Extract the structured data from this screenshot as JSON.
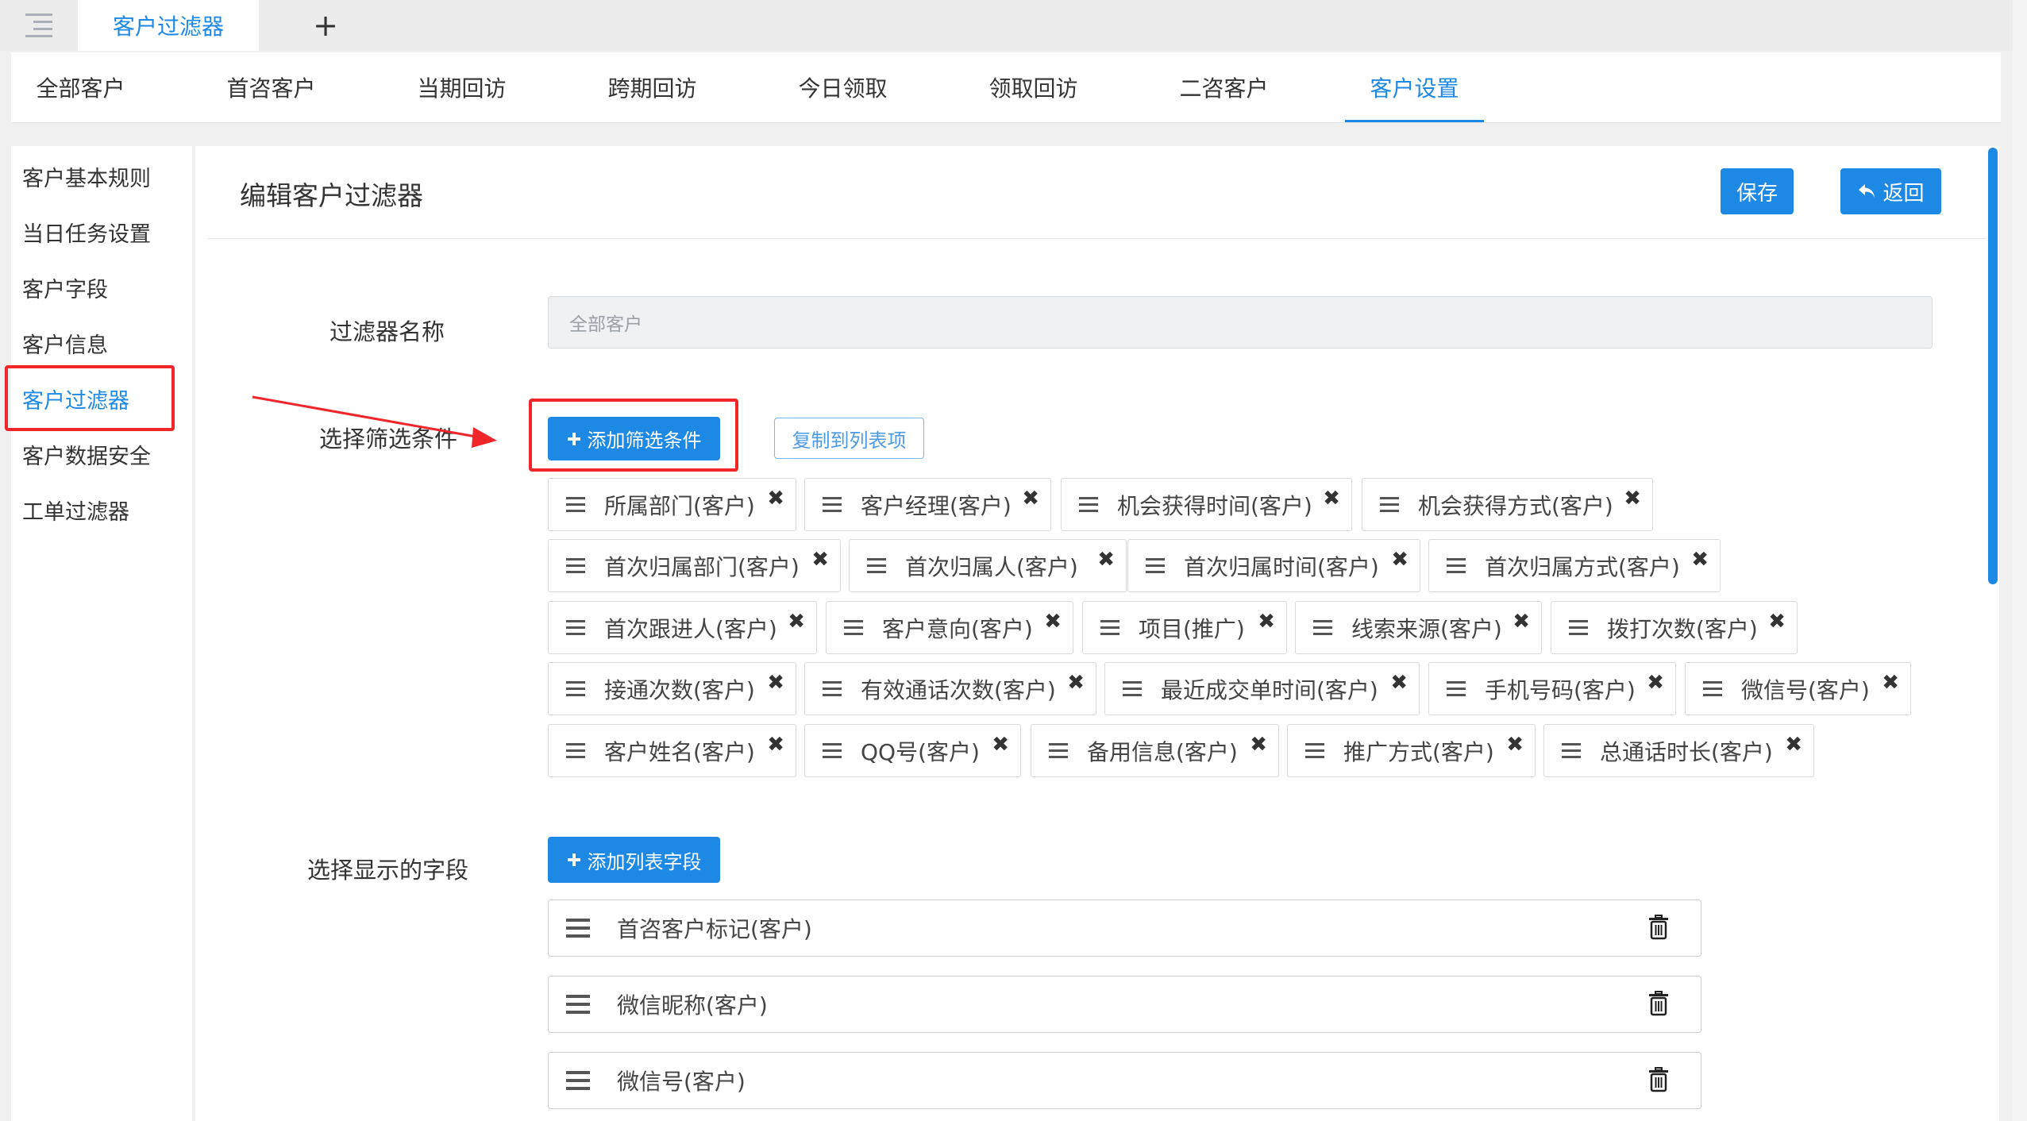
{
  "top_tabs": {
    "active_tab": "客户过滤器",
    "add_symbol": "+"
  },
  "subtabs": [
    "全部客户",
    "首咨客户",
    "当期回访",
    "跨期回访",
    "今日领取",
    "领取回访",
    "二咨客户",
    "客户设置"
  ],
  "sidebar": [
    "客户基本规则",
    "当日任务设置",
    "客户字段",
    "客户信息",
    "客户过滤器",
    "客户数据安全",
    "工单过滤器"
  ],
  "panel": {
    "title": "编辑客户过滤器",
    "save": "保存",
    "back": "返回"
  },
  "form": {
    "name_label": "过滤器名称",
    "name_value": "全部客户",
    "conditions_label": "选择筛选条件",
    "add_condition": "添加筛选条件",
    "copy_to_list": "复制到列表项",
    "conditions": [
      "所属部门(客户)",
      "客户经理(客户)",
      "机会获得时间(客户)",
      "机会获得方式(客户)",
      "首次归属部门(客户)",
      "首次归属人(客户)",
      "首次归属时间(客户)",
      "首次归属方式(客户)",
      "首次跟进人(客户)",
      "客户意向(客户)",
      "项目(推广)",
      "线索来源(客户)",
      "拨打次数(客户)",
      "接通次数(客户)",
      "有效通话次数(客户)",
      "最近成交单时间(客户)",
      "手机号码(客户)",
      "微信号(客户)",
      "客户姓名(客户)",
      "QQ号(客户)",
      "备用信息(客户)",
      "推广方式(客户)",
      "总通话时长(客户)"
    ],
    "fields_label": "选择显示的字段",
    "add_field": "添加列表字段",
    "fields": [
      "首咨客户标记(客户)",
      "微信昵称(客户)",
      "微信号(客户)"
    ]
  },
  "colors": {
    "accent": "#1e88e5",
    "highlight": "#f0262a"
  }
}
